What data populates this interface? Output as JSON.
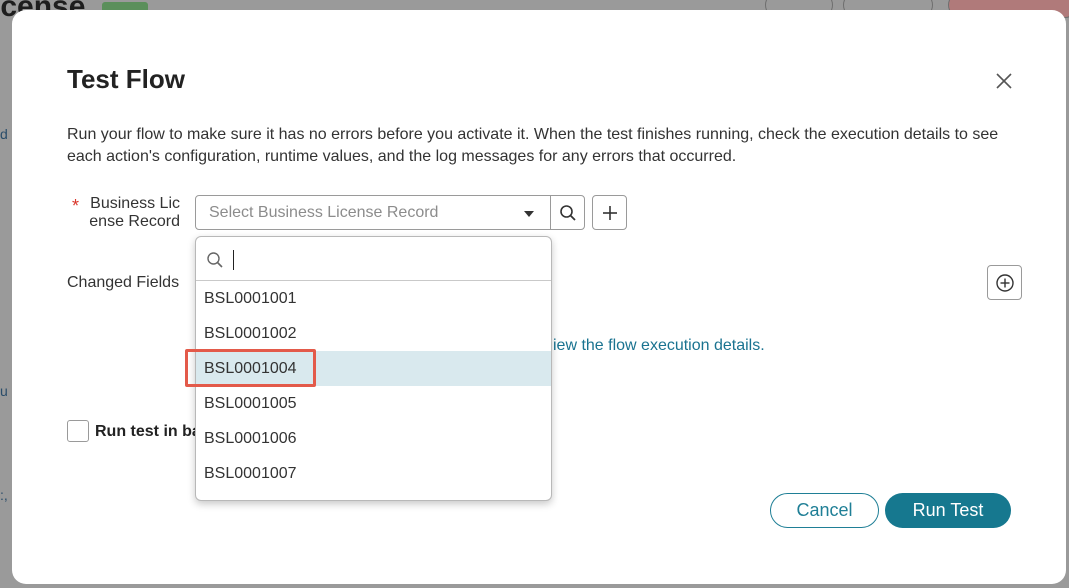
{
  "background": {
    "title_fragment": "icense"
  },
  "modal": {
    "title": "Test Flow",
    "description": "Run your flow to make sure it has no errors before you activate it. When the test finishes running, check the execution details to see each action's configuration, runtime values, and the log messages for any errors that occurred.",
    "record_field": {
      "label": "Business License Record",
      "placeholder": "Select Business License Record"
    },
    "changed_fields_label": "Changed Fields",
    "exec_link_text": "iew the flow execution details.",
    "checkbox_label": "Run test in ba",
    "cancel_label": "Cancel",
    "run_label": "Run Test"
  },
  "dropdown": {
    "search_value": "",
    "options": [
      "BSL0001001",
      "BSL0001002",
      "BSL0001004",
      "BSL0001005",
      "BSL0001006",
      "BSL0001007"
    ],
    "highlighted": "BSL0001004"
  },
  "colors": {
    "accent": "#16788f",
    "required": "#d9352a",
    "highlight_row": "#d9e9ee",
    "annotation_outline": "#e35a4a"
  }
}
